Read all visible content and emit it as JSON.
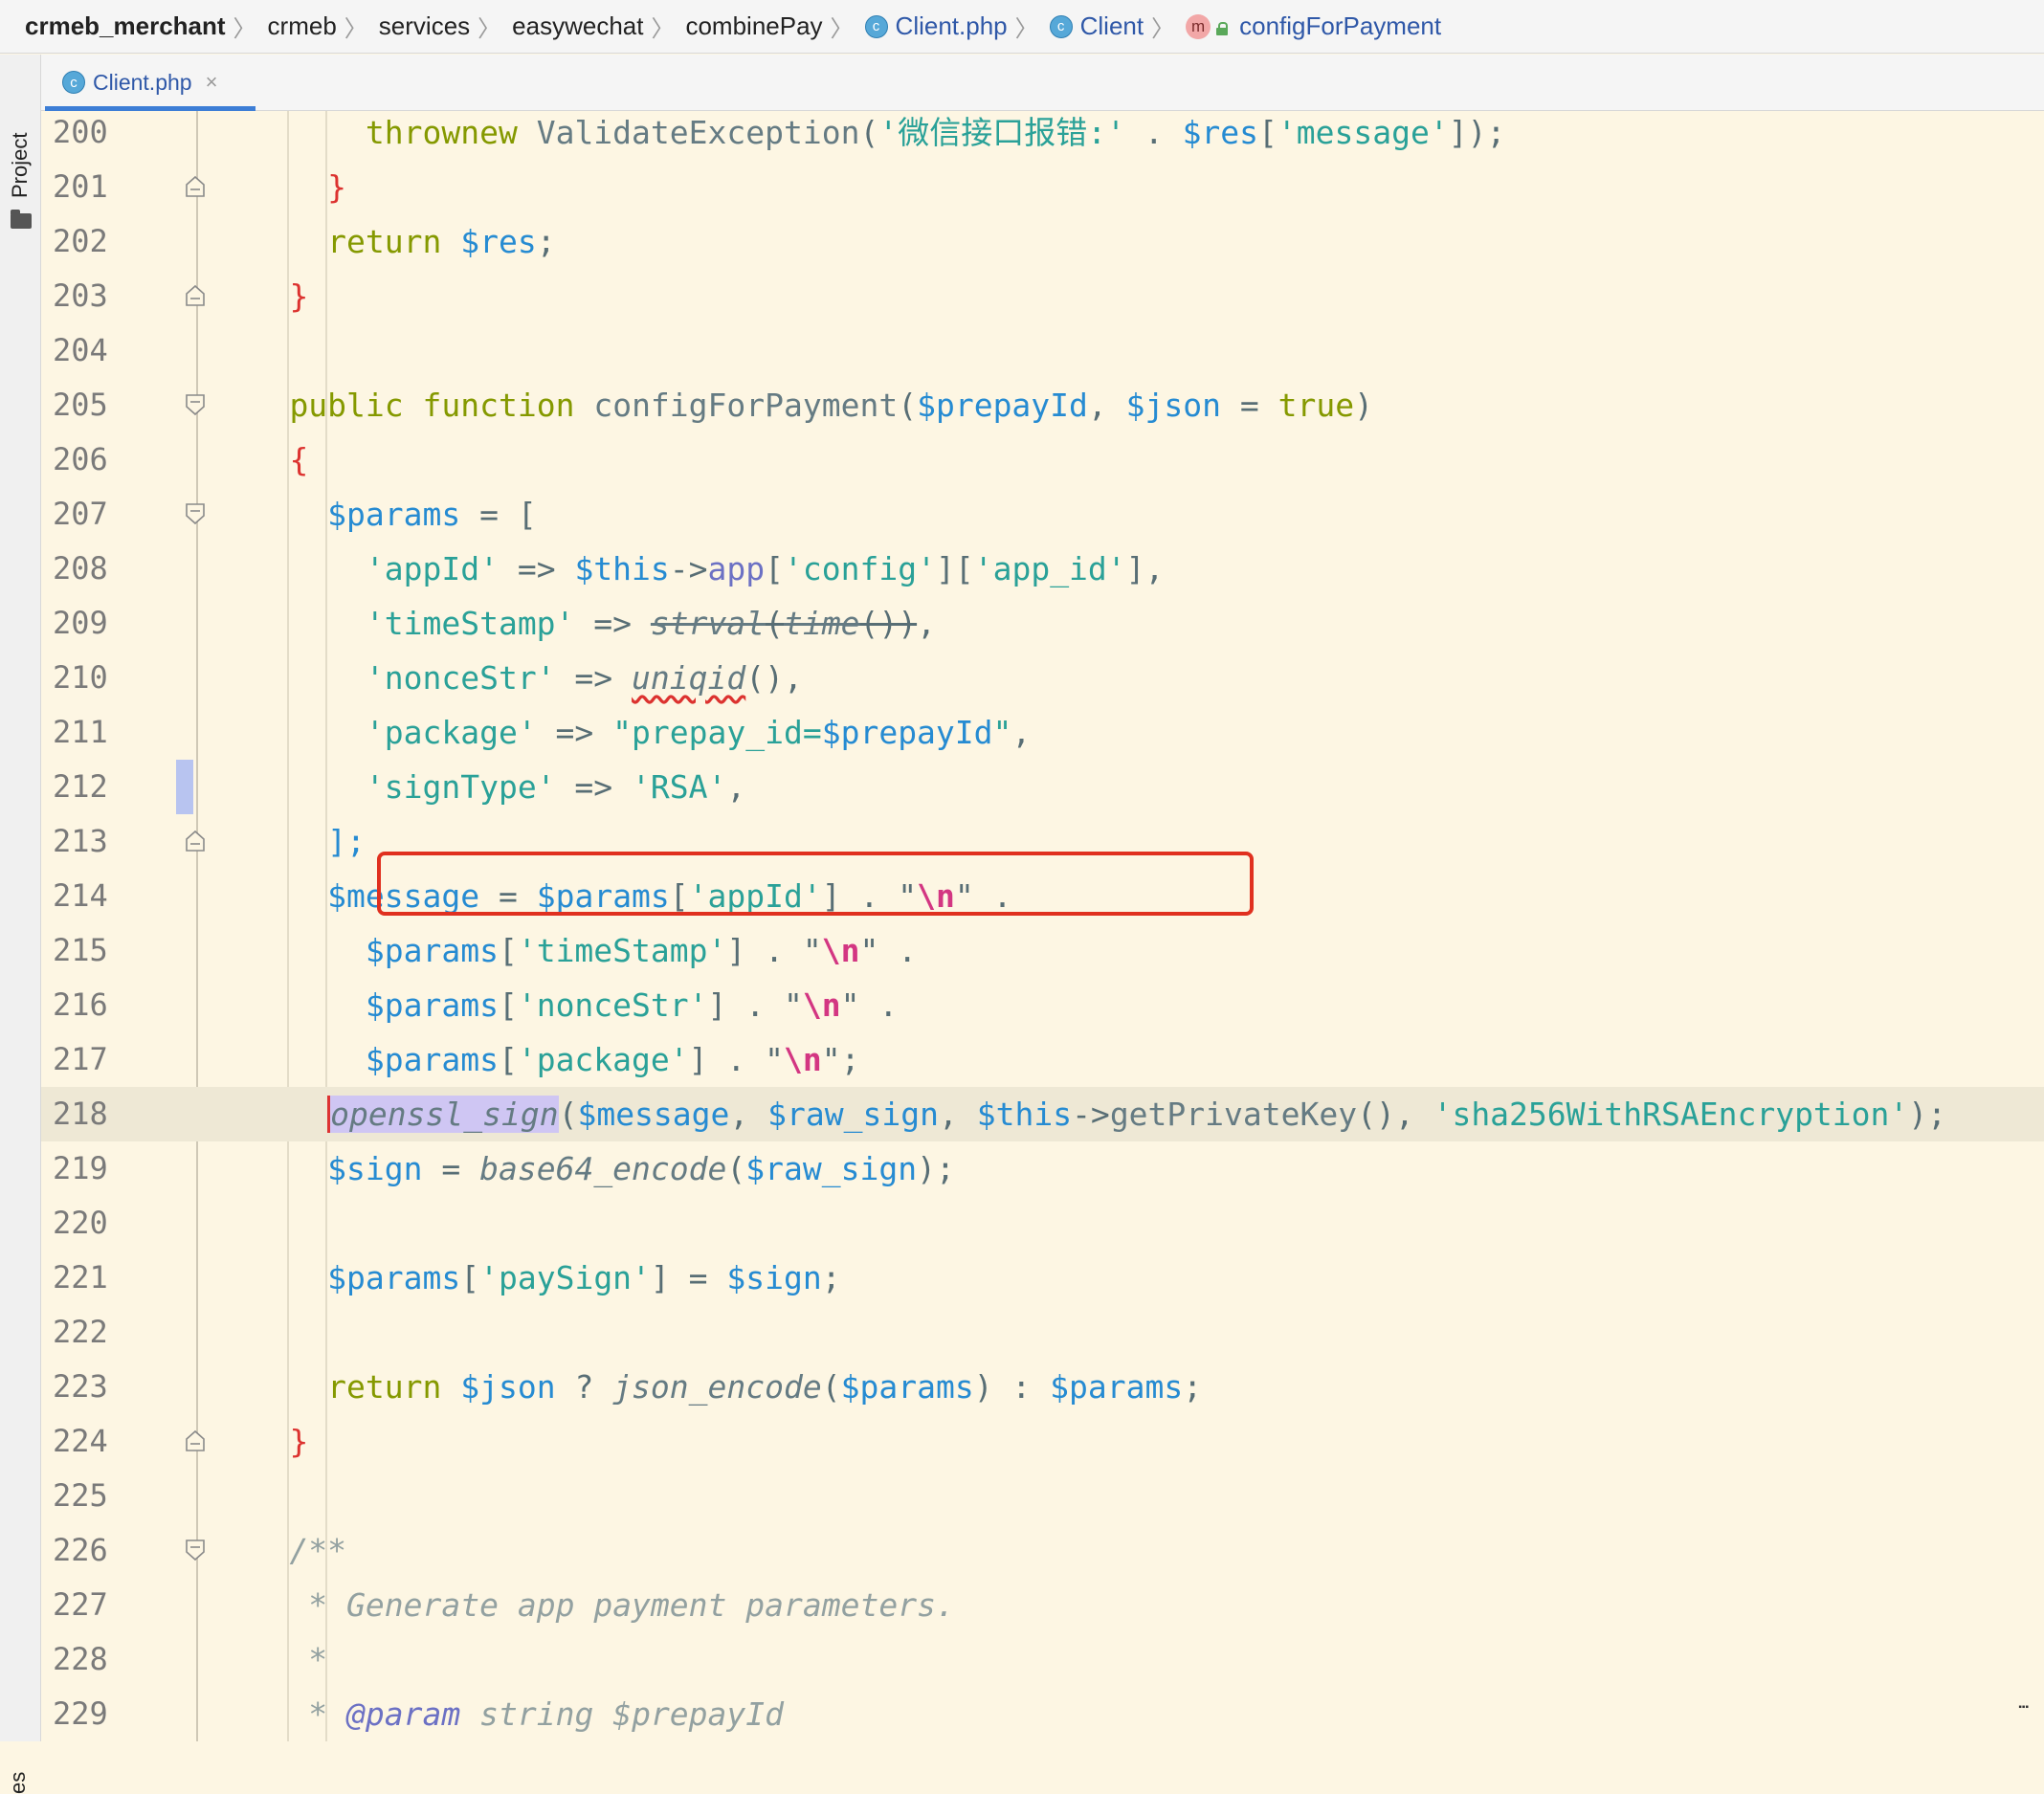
{
  "breadcrumb": {
    "items": [
      "crmeb_merchant",
      "crmeb",
      "services",
      "easywechat",
      "combinePay",
      "Client.php",
      "Client",
      "configForPayment"
    ],
    "class_badge": "c",
    "method_badge": "m"
  },
  "tool_strip": {
    "project_label": "Project",
    "bottom_label": "es"
  },
  "tab": {
    "label": "Client.php",
    "close": "×"
  },
  "editor": {
    "current_line": 218,
    "highlighted_line": 212
  },
  "lines": [
    {
      "n": "200"
    },
    {
      "n": "201"
    },
    {
      "n": "202"
    },
    {
      "n": "203"
    },
    {
      "n": "204"
    },
    {
      "n": "205"
    },
    {
      "n": "206"
    },
    {
      "n": "207"
    },
    {
      "n": "208"
    },
    {
      "n": "209"
    },
    {
      "n": "210"
    },
    {
      "n": "211"
    },
    {
      "n": "212"
    },
    {
      "n": "213"
    },
    {
      "n": "214"
    },
    {
      "n": "215"
    },
    {
      "n": "216"
    },
    {
      "n": "217"
    },
    {
      "n": "218"
    },
    {
      "n": "219"
    },
    {
      "n": "220"
    },
    {
      "n": "221"
    },
    {
      "n": "222"
    },
    {
      "n": "223"
    },
    {
      "n": "224"
    },
    {
      "n": "225"
    },
    {
      "n": "226"
    },
    {
      "n": "227"
    },
    {
      "n": "228"
    },
    {
      "n": "229"
    }
  ],
  "code": {
    "l200": [
      "throw",
      "new",
      "ValidateException",
      "(",
      "'微信接口报错:'",
      " . ",
      "$res",
      "[",
      "'message'",
      "]);"
    ],
    "l201": [
      "}"
    ],
    "l202": [
      "return",
      "$res",
      ";"
    ],
    "l203": [
      "}"
    ],
    "l205": [
      "public",
      "function",
      "configForPayment",
      "(",
      "$prepayId",
      ", ",
      "$json",
      " = ",
      "true",
      ")"
    ],
    "l206": [
      "{"
    ],
    "l207": [
      "$params",
      " = ["
    ],
    "l208": [
      "'appId'",
      " => ",
      "$this",
      "->",
      "app",
      "[",
      "'config'",
      "][",
      "'app_id'",
      "],"
    ],
    "l209": [
      "'timeStamp'",
      " => ",
      "strval",
      "(",
      "time",
      "())",
      ","
    ],
    "l210": [
      "'nonceStr'",
      " => ",
      "uniqid",
      "()",
      ","
    ],
    "l211": [
      "'package'",
      " => ",
      "\"prepay_id=",
      "$prepayId",
      "\"",
      ","
    ],
    "l212": [
      "'signType'",
      " => ",
      "'RSA'",
      ","
    ],
    "l213": [
      "];"
    ],
    "l214": [
      "$message",
      " = ",
      "$params",
      "[",
      "'appId'",
      "] . ",
      "\"",
      "\\n",
      "\"",
      " ."
    ],
    "l215": [
      "$params",
      "[",
      "'timeStamp'",
      "] . ",
      "\"",
      "\\n",
      "\"",
      " ."
    ],
    "l216": [
      "$params",
      "[",
      "'nonceStr'",
      "] . ",
      "\"",
      "\\n",
      "\"",
      " ."
    ],
    "l217": [
      "$params",
      "[",
      "'package'",
      "] . ",
      "\"",
      "\\n",
      "\"",
      ";"
    ],
    "l218": [
      "openssl_sign",
      "(",
      "$message",
      ", ",
      "$raw_sign",
      ", ",
      "$this",
      "->",
      "getPrivateKey",
      "(), ",
      "'sha256WithRSAEncryption'",
      ");"
    ],
    "l219": [
      "$sign",
      " = ",
      "base64_encode",
      "(",
      "$raw_sign",
      ");"
    ],
    "l221": [
      "$params",
      "[",
      "'paySign'",
      "] = ",
      "$sign",
      ";"
    ],
    "l223": [
      "return",
      "$json",
      " ? ",
      "json_encode",
      "(",
      "$params",
      ") : ",
      "$params",
      ";"
    ],
    "l224": [
      "}"
    ],
    "l226": [
      "/**"
    ],
    "l227": [
      " * Generate app payment parameters."
    ],
    "l228": [
      " *"
    ],
    "l229": [
      " * ",
      "@param",
      " string $prepayId"
    ]
  },
  "colors": {
    "background": "#fdf6e3",
    "keyword": "#859900",
    "variable": "#268bd2",
    "string": "#2aa198",
    "highlight_box": "#e0301f"
  }
}
